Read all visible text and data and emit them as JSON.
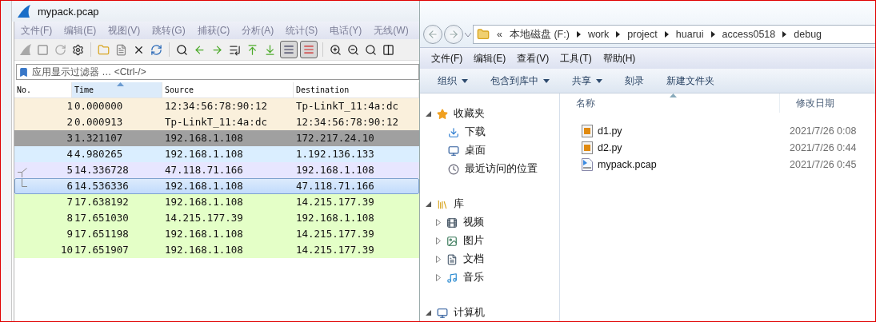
{
  "wireshark": {
    "title": "mypack.pcap",
    "menu": [
      "文件(F)",
      "编辑(E)",
      "视图(V)",
      "跳转(G)",
      "捕获(C)",
      "分析(A)",
      "统计(S)",
      "电话(Y)",
      "无线(W)"
    ],
    "toolbar": {
      "auto_scroll_on": true,
      "colorize_on": true
    },
    "filter": {
      "placeholder": "应用显示过滤器 … <Ctrl-/>"
    },
    "columns": [
      {
        "label": "No.",
        "sorted": false
      },
      {
        "label": "Time",
        "sorted": true
      },
      {
        "label": "Source",
        "sorted": false
      },
      {
        "label": "Destination",
        "sorted": false
      }
    ],
    "rows": [
      {
        "cells": [
          "1",
          "0.000000",
          "12:34:56:78:90:12",
          "Tp-LinkT_11:4a:dc"
        ],
        "color": "#faf0dc",
        "selected": false
      },
      {
        "cells": [
          "2",
          "0.000913",
          "Tp-LinkT_11:4a:dc",
          "12:34:56:78:90:12"
        ],
        "color": "#faf0dc",
        "selected": false
      },
      {
        "cells": [
          "3",
          "1.321107",
          "192.168.1.108",
          "172.217.24.10"
        ],
        "color": "#a0a0a0",
        "selected": false
      },
      {
        "cells": [
          "4",
          "4.980265",
          "192.168.1.108",
          "1.192.136.133"
        ],
        "color": "#daeeff",
        "selected": false
      },
      {
        "cells": [
          "5",
          "14.336728",
          "47.118.71.166",
          "192.168.1.108"
        ],
        "color": "#e7e6ff",
        "selected": false,
        "conversation_start": true
      },
      {
        "cells": [
          "6",
          "14.536336",
          "192.168.1.108",
          "47.118.71.166"
        ],
        "color": "#e7e6ff",
        "selected": true,
        "conversation_end": true
      },
      {
        "cells": [
          "7",
          "17.638192",
          "192.168.1.108",
          "14.215.177.39"
        ],
        "color": "#e4ffc7",
        "selected": false
      },
      {
        "cells": [
          "8",
          "17.651030",
          "14.215.177.39",
          "192.168.1.108"
        ],
        "color": "#e4ffc7",
        "selected": false
      },
      {
        "cells": [
          "9",
          "17.651198",
          "192.168.1.108",
          "14.215.177.39"
        ],
        "color": "#e4ffc7",
        "selected": false
      },
      {
        "cells": [
          "10",
          "17.651907",
          "192.168.1.108",
          "14.215.177.39"
        ],
        "color": "#e4ffc7",
        "selected": false
      }
    ]
  },
  "explorer": {
    "breadcrumb_lead": "«",
    "breadcrumb": [
      "本地磁盘 (F:)",
      "work",
      "project",
      "huarui",
      "access0518",
      "debug"
    ],
    "menu": [
      "文件(F)",
      "编辑(E)",
      "查看(V)",
      "工具(T)",
      "帮助(H)"
    ],
    "commands": [
      {
        "label": "组织",
        "dropdown": true
      },
      {
        "label": "包含到库中",
        "dropdown": true
      },
      {
        "label": "共享",
        "dropdown": true
      },
      {
        "label": "刻录",
        "dropdown": false
      },
      {
        "label": "新建文件夹",
        "dropdown": false
      }
    ],
    "nav": [
      {
        "label": "收藏夹",
        "kind": "star",
        "expanded": true,
        "children": [
          {
            "label": "下载",
            "kind": "download"
          },
          {
            "label": "桌面",
            "kind": "desktop"
          },
          {
            "label": "最近访问的位置",
            "kind": "recent"
          }
        ]
      },
      {
        "label": "库",
        "kind": "library",
        "expanded": true,
        "children": [
          {
            "label": "视频",
            "kind": "video",
            "expanded": false
          },
          {
            "label": "图片",
            "kind": "picture",
            "expanded": false
          },
          {
            "label": "文档",
            "kind": "document",
            "expanded": false
          },
          {
            "label": "音乐",
            "kind": "music",
            "expanded": false
          }
        ]
      },
      {
        "label": "计算机",
        "kind": "computer",
        "expanded": true
      }
    ],
    "columns": [
      {
        "label": "名称",
        "sorted": true
      },
      {
        "label": "修改日期",
        "sorted": false
      }
    ],
    "files": [
      {
        "name": "d1.py",
        "kind": "python",
        "modified": "2021/7/26 0:08"
      },
      {
        "name": "d2.py",
        "kind": "python",
        "modified": "2021/7/26 0:44"
      },
      {
        "name": "mypack.pcap",
        "kind": "capture",
        "modified": "2021/7/26 0:45"
      }
    ]
  }
}
